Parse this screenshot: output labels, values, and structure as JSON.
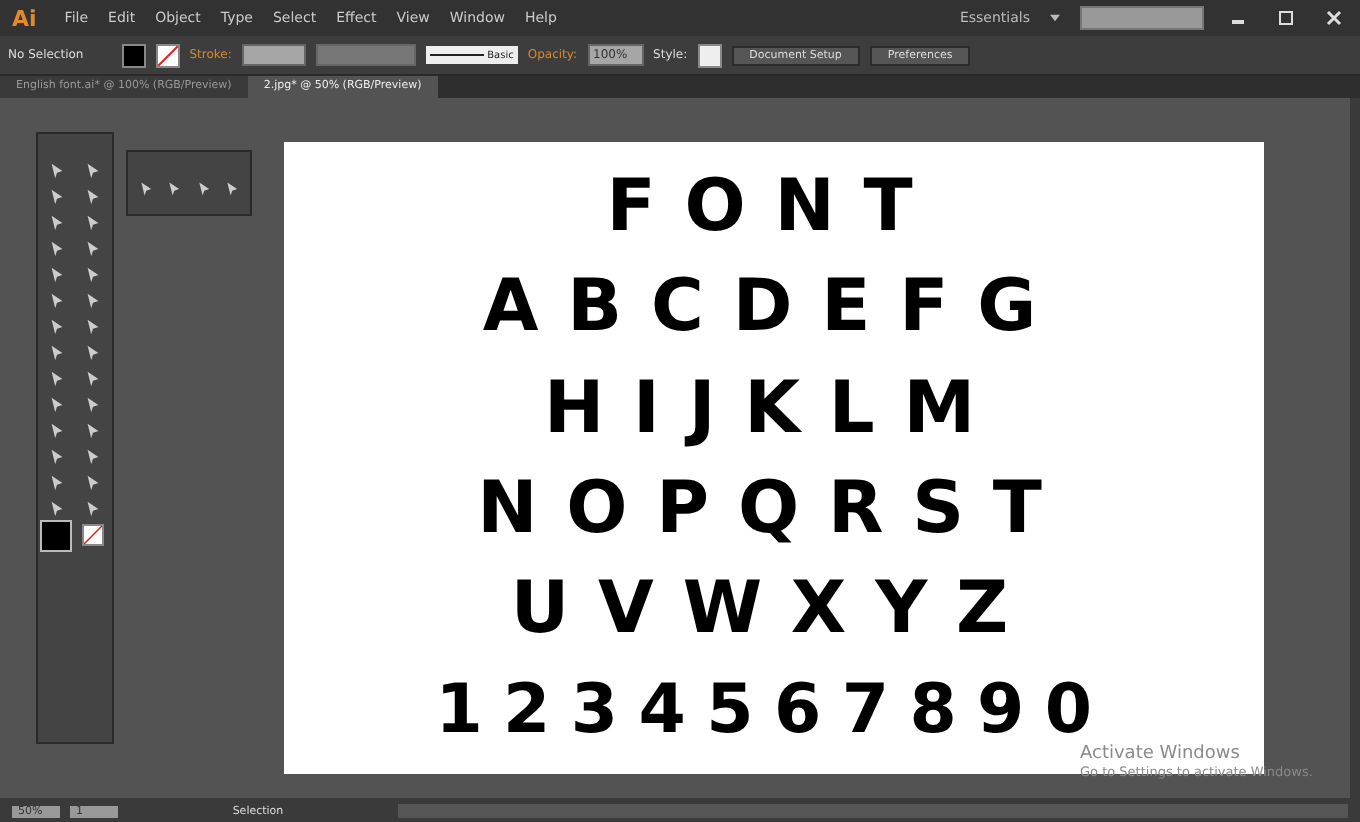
{
  "app": {
    "logo": "Ai",
    "workspace": "Essentials"
  },
  "menu": [
    "File",
    "Edit",
    "Object",
    "Type",
    "Select",
    "Effect",
    "View",
    "Window",
    "Help"
  ],
  "control_bar": {
    "selection": "No Selection",
    "stroke_label": "Stroke:",
    "brush": "Basic",
    "opacity_label": "Opacity:",
    "opacity": "100%",
    "style_label": "Style:",
    "buttons": [
      "Document Setup",
      "Preferences"
    ]
  },
  "tabs": [
    {
      "label": "English font.ai* @ 100% (RGB/Preview)",
      "selected": false
    },
    {
      "label": "2.jpg* @ 50% (RGB/Preview)",
      "selected": true
    }
  ],
  "artwork_rows": [
    "FONT",
    "ABCDEFG",
    "HIJKLM",
    "NOPQRST",
    "UVWXYZ",
    "1234567890"
  ],
  "status_bar": {
    "zoom": "50%",
    "page": "1",
    "tool": "Selection"
  },
  "system_notice": {
    "title": "Activate Windows",
    "message": "Go to Settings to activate Windows."
  }
}
